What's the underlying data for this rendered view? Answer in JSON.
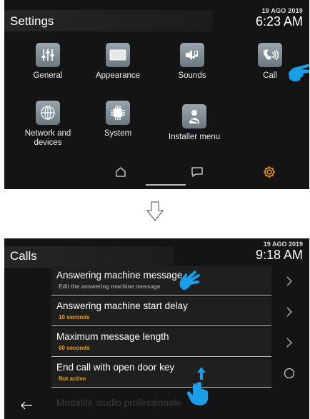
{
  "settings_screen": {
    "title": "Settings",
    "date": "19 AGO 2019",
    "time": "6:23 AM",
    "tiles": [
      {
        "label": "General",
        "icon": "sliders-icon"
      },
      {
        "label": "Appearance",
        "icon": "display-icon"
      },
      {
        "label": "Sounds",
        "icon": "speaker-music-icon"
      },
      {
        "label": "Call",
        "icon": "handset-signal-icon"
      },
      {
        "label": "Network and devices",
        "icon": "globe-icon"
      },
      {
        "label": "System",
        "icon": "chip-icon"
      },
      {
        "label": "Installer menu",
        "icon": "installer-wrench-icon"
      }
    ],
    "nav": [
      "home-icon",
      "chat-icon",
      "gear-icon"
    ],
    "colors": {
      "accent": "#f0a000",
      "hand": "#1a9ee8"
    }
  },
  "calls_screen": {
    "title": "Calls",
    "date": "19 AGO 2019",
    "time": "9:18 AM",
    "rows": [
      {
        "title": "Answering machine message",
        "subtitle": "Edit the answering machine message",
        "control": "chevron-right-icon"
      },
      {
        "title": "Answering machine start delay",
        "subtitle": "10 seconds",
        "control": "chevron-right-icon"
      },
      {
        "title": "Maximum message length",
        "subtitle": "60 seconds",
        "control": "chevron-right-icon"
      },
      {
        "title": "End call with open door key",
        "subtitle": "Not active",
        "control": "radio-icon"
      }
    ],
    "faded_row": "Modalità studio professionale",
    "colors": {
      "subtitle_accent": "#f0a000",
      "subtitle_muted": "#9a9a9a"
    }
  }
}
